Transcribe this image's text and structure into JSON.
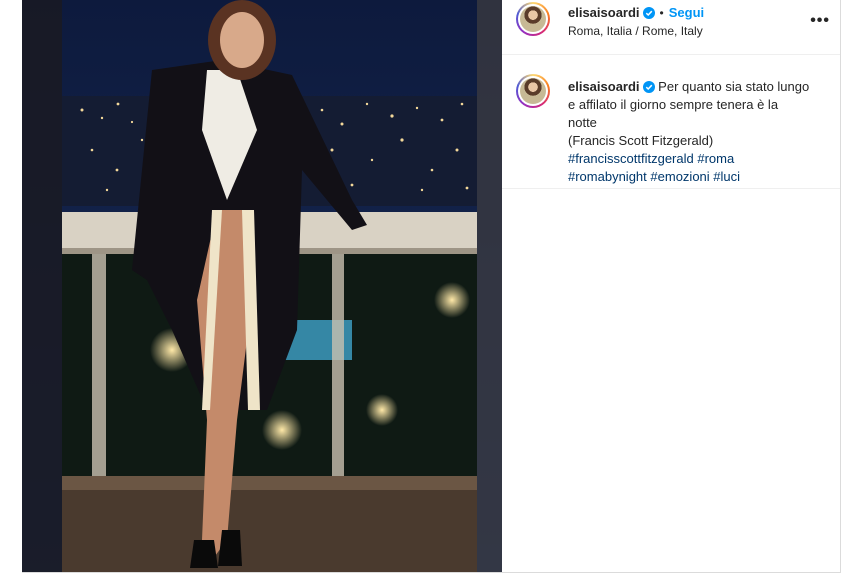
{
  "post": {
    "author": {
      "username": "elisaisoardi",
      "verified": true,
      "follow_label": "Segui",
      "separator": "•",
      "location": "Roma, Italia / Rome, Italy"
    },
    "more_icon": "more-horizontal-icon",
    "caption": {
      "username": "elisaisoardi",
      "line1": "Per quanto sia stato lungo",
      "line2": "e affilato il giorno sempre tenera è la",
      "line3": "notte",
      "line4": "(Francis Scott Fitzgerald)",
      "hashtags": [
        "#francisscottfitzgerald",
        "#roma",
        "#romabynight",
        "#emozioni",
        "#luci"
      ]
    },
    "colors": {
      "link_blue": "#0095f6",
      "hashtag": "#00376b",
      "verified_badge": "#0095f6"
    }
  }
}
